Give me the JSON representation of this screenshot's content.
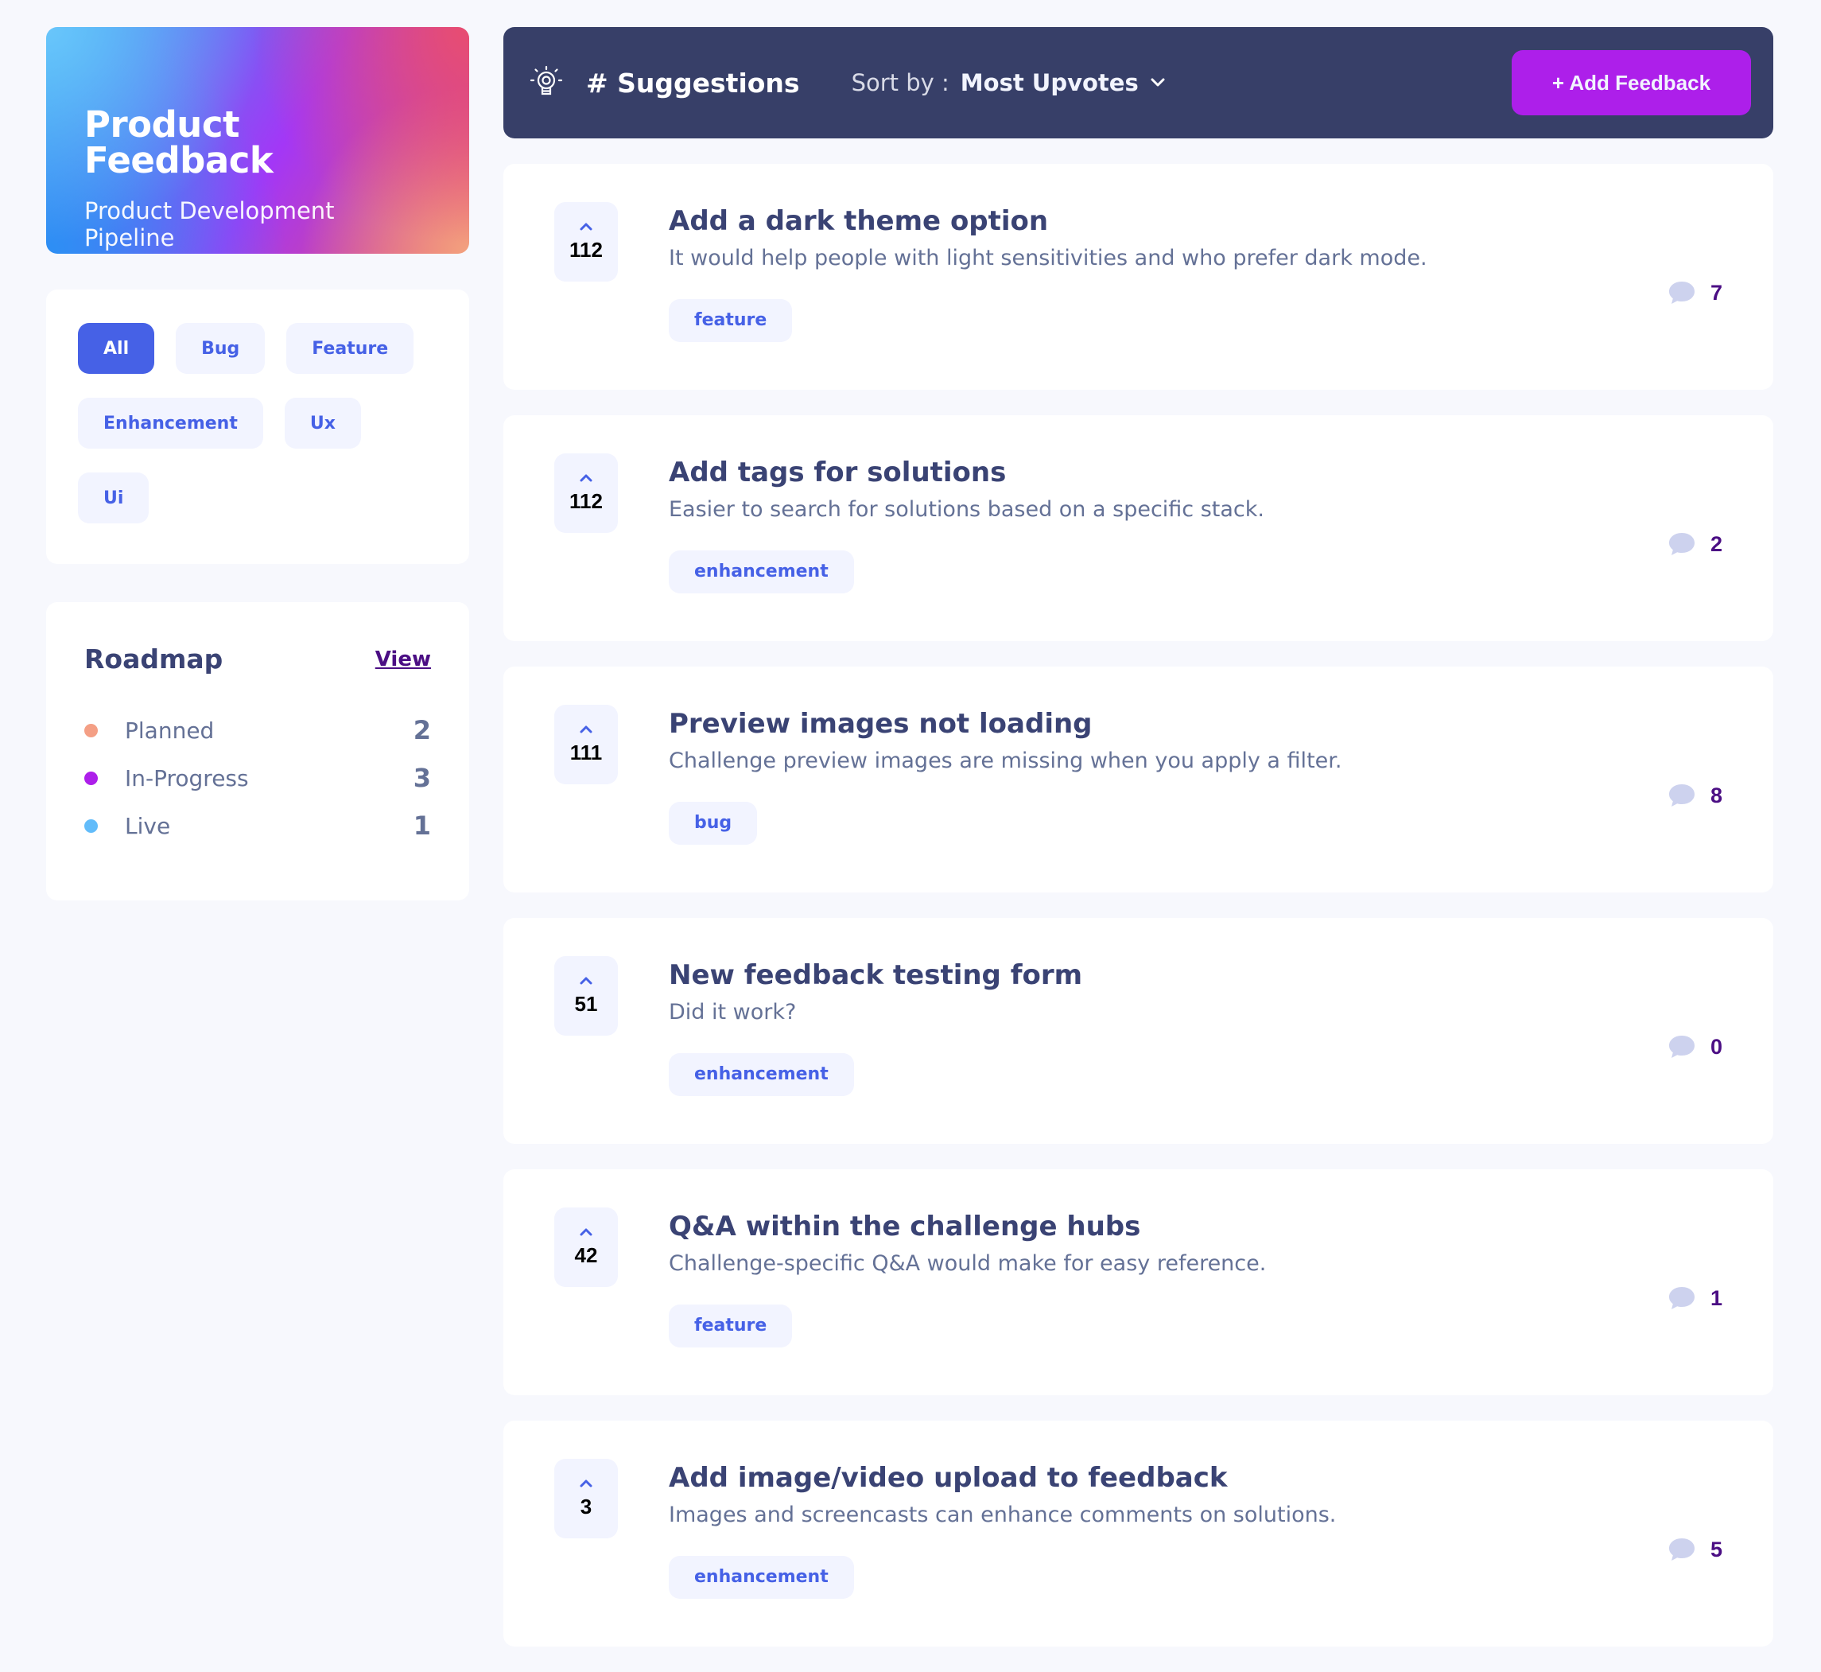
{
  "brand": {
    "title": "Product Feedback",
    "subtitle": "Product Development Pipeline"
  },
  "filters": [
    {
      "label": "All",
      "active": true
    },
    {
      "label": "Bug",
      "active": false
    },
    {
      "label": "Feature",
      "active": false
    },
    {
      "label": "Enhancement",
      "active": false
    },
    {
      "label": "Ux",
      "active": false
    },
    {
      "label": "Ui",
      "active": false
    }
  ],
  "roadmap": {
    "title": "Roadmap",
    "view_label": "View",
    "items": [
      {
        "label": "Planned",
        "count": "2",
        "color": "#f49f85"
      },
      {
        "label": "In-Progress",
        "count": "3",
        "color": "#ad1fea"
      },
      {
        "label": "Live",
        "count": "1",
        "color": "#62bcfa"
      }
    ]
  },
  "topbar": {
    "title": "# Suggestions",
    "sort_label": "Sort by :",
    "sort_value": "Most Upvotes",
    "add_button": "+ Add Feedback",
    "icons": [
      "bulb-icon",
      "chevron-down-icon"
    ]
  },
  "feedback": [
    {
      "votes": "112",
      "title": "Add a dark theme option",
      "description": "It would help people with light sensitivities and who prefer dark mode.",
      "tag": "feature",
      "comments": "7"
    },
    {
      "votes": "112",
      "title": "Add tags for solutions",
      "description": "Easier to search for solutions based on a specific stack.",
      "tag": "enhancement",
      "comments": "2"
    },
    {
      "votes": "111",
      "title": "Preview images not loading",
      "description": "Challenge preview images are missing when you apply a filter.",
      "tag": "bug",
      "comments": "8"
    },
    {
      "votes": "51",
      "title": "New feedback testing form",
      "description": "Did it work?",
      "tag": "enhancement",
      "comments": "0"
    },
    {
      "votes": "42",
      "title": "Q&A within the challenge hubs",
      "description": "Challenge-specific Q&A would make for easy reference.",
      "tag": "feature",
      "comments": "1"
    },
    {
      "votes": "3",
      "title": "Add image/video upload to feedback",
      "description": "Images and screencasts can enhance comments on solutions.",
      "tag": "enhancement",
      "comments": "5"
    }
  ],
  "colors": {
    "accent_purple": "#ad1fea",
    "accent_blue": "#4661e6",
    "navy": "#373f68",
    "background": "#f7f8fd"
  }
}
